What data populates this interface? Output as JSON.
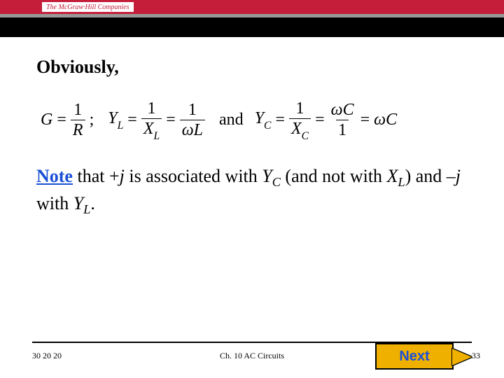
{
  "header": {
    "brand": "The McGraw·Hill Companies"
  },
  "body": {
    "lead": "Obviously,",
    "equation": {
      "G": "G",
      "eq": "=",
      "one": "1",
      "R": "R",
      "semi": ";",
      "YL": "Y",
      "YL_sub": "L",
      "XL": "X",
      "XL_sub": "L",
      "wL": "ωL",
      "and": "and",
      "YC": "Y",
      "YC_sub": "C",
      "XC": "X",
      "XC_sub": "C",
      "wC_num": "ωC",
      "one2": "1",
      "wC": "ωC"
    },
    "note": {
      "word": "Note",
      "t1": " that +",
      "j": "j",
      "t2": " is associated with ",
      "YC": "Y",
      "YC_sub": "C",
      "t3": " (and not with ",
      "XL": "X",
      "XL_sub": "L",
      "t4": ") and –",
      "t5": " with ",
      "YL": "Y",
      "YL_sub": "L",
      "t6": "."
    }
  },
  "footer": {
    "date": "30​​​​​ ​2​0 2​0",
    "chapter": "Ch. 10 AC Circuits",
    "next": "Next",
    "page": "33"
  }
}
